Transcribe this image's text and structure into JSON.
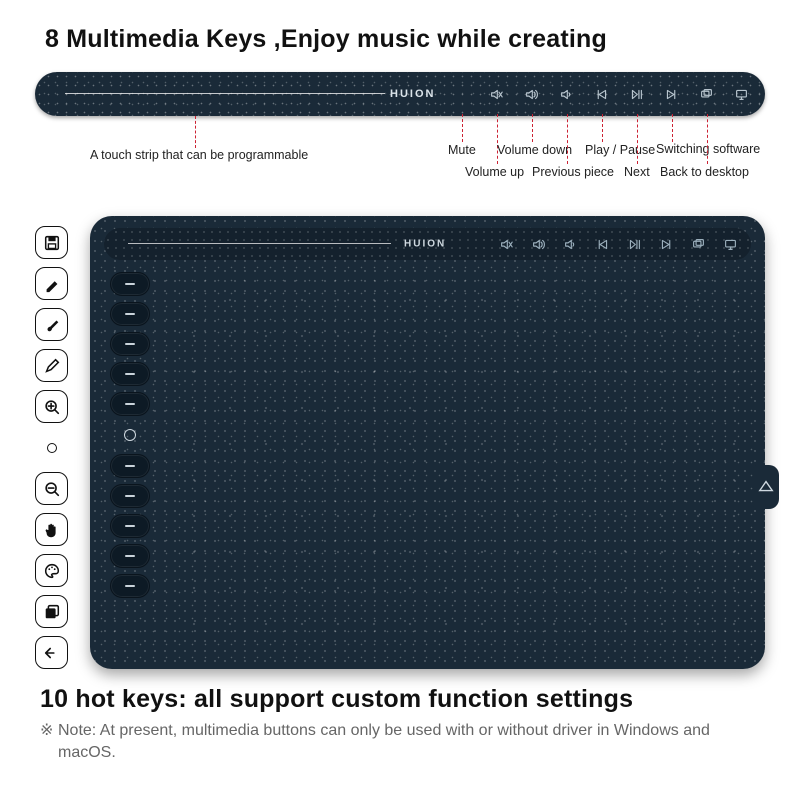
{
  "headings": {
    "top": "8 Multimedia Keys ,Enjoy music while creating",
    "bottom": "10 hot keys: all support custom function settings",
    "note_symbol": "※",
    "note": "Note: At present, multimedia buttons can only be used with or without driver in Windows and macOS."
  },
  "brand": "HUION",
  "touch_strip_label": "A touch strip that can be programmable",
  "multimedia_keys": [
    {
      "name": "mute",
      "label": "Mute",
      "icon": "speaker-mute"
    },
    {
      "name": "volume-up",
      "label": "Volume up",
      "icon": "speaker-plus"
    },
    {
      "name": "volume-down",
      "label": "Volume down",
      "icon": "speaker-minus"
    },
    {
      "name": "previous",
      "label": "Previous piece",
      "icon": "prev-track"
    },
    {
      "name": "play-pause",
      "label": "Play / Pause",
      "icon": "play-pause"
    },
    {
      "name": "next",
      "label": "Next",
      "icon": "next-track"
    },
    {
      "name": "switch-software",
      "label": "Switching software",
      "icon": "window-stack"
    },
    {
      "name": "back-to-desktop",
      "label": "Back to desktop",
      "icon": "desktop"
    }
  ],
  "hotkeys": [
    {
      "name": "save",
      "icon": "floppy"
    },
    {
      "name": "pen",
      "icon": "pen"
    },
    {
      "name": "brush",
      "icon": "brush"
    },
    {
      "name": "pencil",
      "icon": "pencil"
    },
    {
      "name": "zoom-in",
      "icon": "zoom-in"
    },
    {
      "name": "center-ring",
      "icon": "ring"
    },
    {
      "name": "zoom-out",
      "icon": "zoom-out"
    },
    {
      "name": "hand",
      "icon": "hand"
    },
    {
      "name": "palette",
      "icon": "palette"
    },
    {
      "name": "layers",
      "icon": "layers"
    },
    {
      "name": "undo",
      "icon": "undo"
    }
  ],
  "colors": {
    "accent": "#c23",
    "surface": "#1a2a38"
  }
}
